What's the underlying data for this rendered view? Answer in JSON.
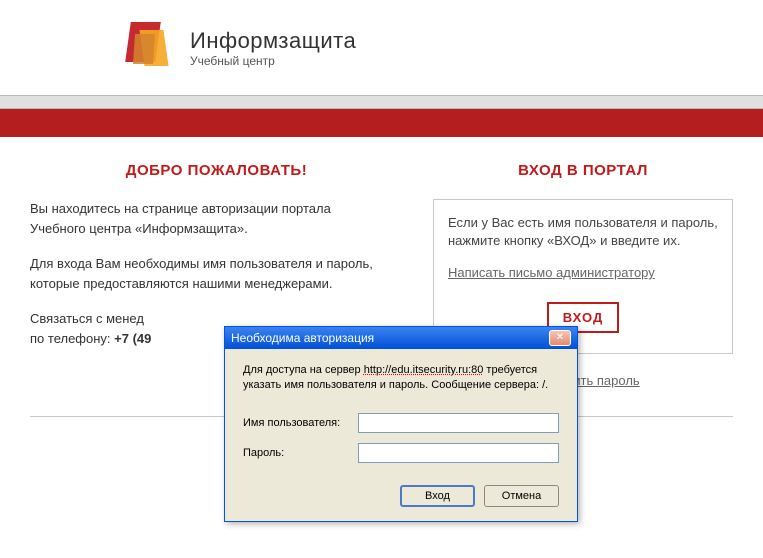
{
  "logo": {
    "title": "Информзащита",
    "subtitle": "Учебный центр"
  },
  "left": {
    "heading": "ДОБРО ПОЖАЛОВАТЬ!",
    "p1a": "Вы находитесь на странице авторизации портала",
    "p1b": "Учебного центра «Информзащита».",
    "p2a": "Для входа Вам необходимы имя пользователя и пароль,",
    "p2b": "которые предоставляются нашими менеджерами.",
    "p3a": "Связаться с менед",
    "p3b": "по телефону: ",
    "phone": "+7 (49"
  },
  "right": {
    "heading": "ВХОД В ПОРТАЛ",
    "info": "Если у Вас есть имя пользователя и пароль, нажмите кнопку «ВХОД» и введите их.",
    "admin_link": "Написать письмо администратору",
    "login_button": "ВХОД",
    "remind_link": "Напомнить пароль"
  },
  "dialog": {
    "title": "Необходима авторизация",
    "msg_a": "Для доступа на сервер ",
    "msg_url": "http://edu.itsecurity.ru:80",
    "msg_b": " требуется указать имя пользователя и пароль. Сообщение сервера: /.",
    "user_label": "Имя пользователя:",
    "pass_label": "Пароль:",
    "user_value": "",
    "pass_value": "",
    "ok": "Вход",
    "cancel": "Отмена",
    "close": "×"
  }
}
